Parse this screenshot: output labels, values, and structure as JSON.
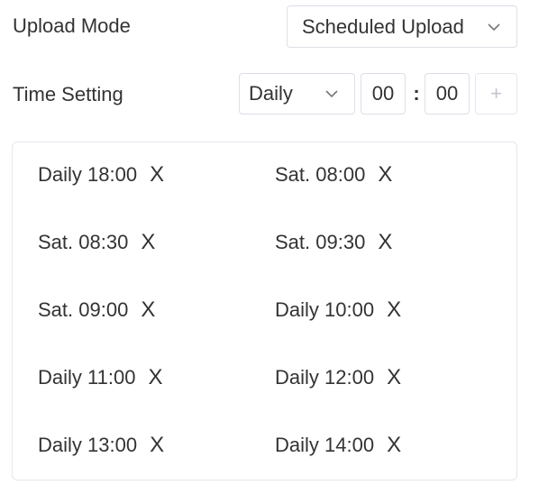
{
  "upload_mode": {
    "label": "Upload Mode",
    "selected": "Scheduled Upload",
    "chevron_icon": "chevron-down-icon"
  },
  "time_setting": {
    "label": "Time Setting",
    "frequency": "Daily",
    "hour": "00",
    "separator": ":",
    "minute": "00",
    "add_label": "+"
  },
  "schedules": [
    {
      "text": "Daily 18:00",
      "remove": "X"
    },
    {
      "text": "Sat. 08:00",
      "remove": "X"
    },
    {
      "text": "Sat. 08:30",
      "remove": "X"
    },
    {
      "text": "Sat. 09:30",
      "remove": "X"
    },
    {
      "text": "Sat. 09:00",
      "remove": "X"
    },
    {
      "text": "Daily 10:00",
      "remove": "X"
    },
    {
      "text": "Daily 11:00",
      "remove": "X"
    },
    {
      "text": "Daily 12:00",
      "remove": "X"
    },
    {
      "text": "Daily 13:00",
      "remove": "X"
    },
    {
      "text": "Daily 14:00",
      "remove": "X"
    }
  ],
  "colors": {
    "text": "#333333",
    "border": "#dcdfe6",
    "muted": "#c0c4cc"
  }
}
